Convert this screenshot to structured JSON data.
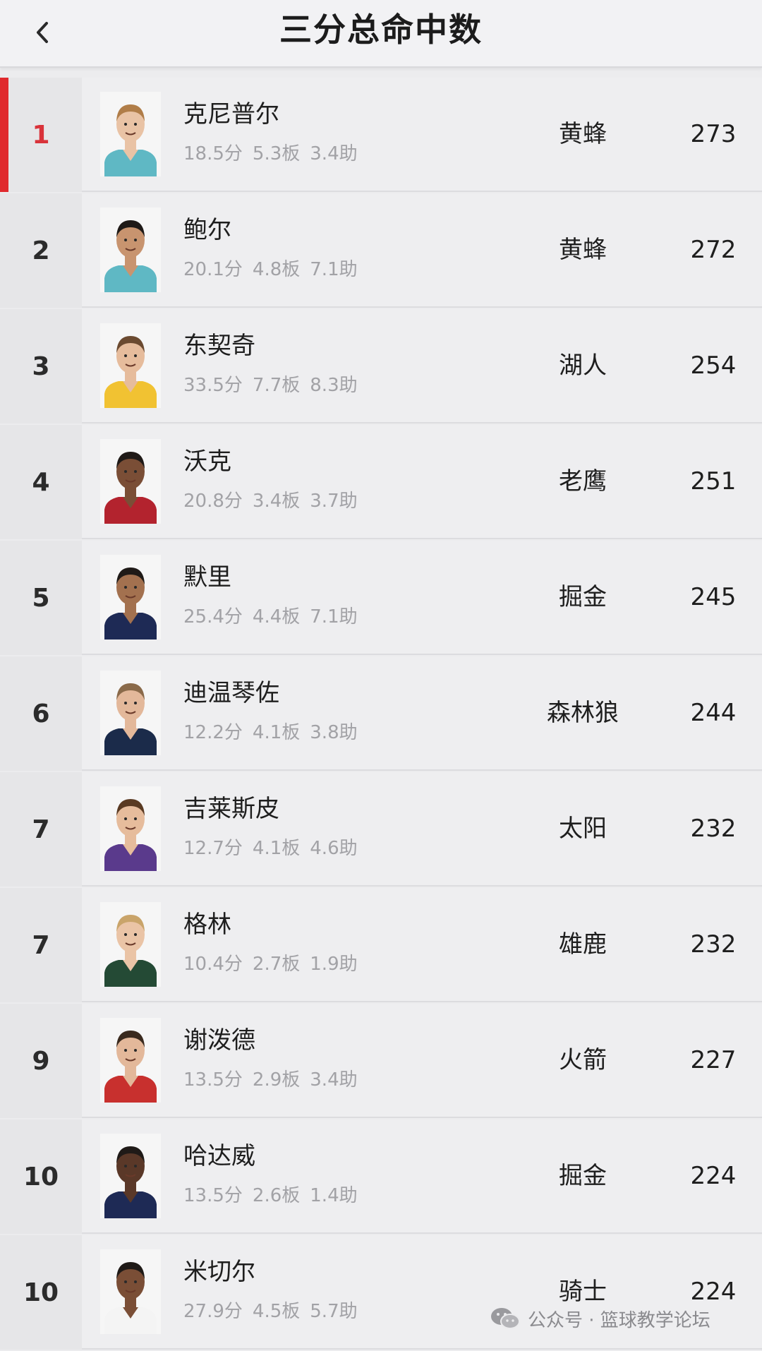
{
  "header": {
    "title": "三分总命中数"
  },
  "rows": [
    {
      "rank": "1",
      "name": "克尼普尔",
      "pts": "18.5分",
      "reb": "5.3板",
      "ast": "3.4助",
      "team": "黄蜂",
      "count": "273",
      "jersey": "#5fb8c4",
      "skin": "#e9c3a5",
      "hair": "#b07d48",
      "top": true
    },
    {
      "rank": "2",
      "name": "鲍尔",
      "pts": "20.1分",
      "reb": "4.8板",
      "ast": "7.1助",
      "team": "黄蜂",
      "count": "272",
      "jersey": "#5fb8c4",
      "skin": "#c8946f",
      "hair": "#1f1a17"
    },
    {
      "rank": "3",
      "name": "东契奇",
      "pts": "33.5分",
      "reb": "7.7板",
      "ast": "8.3助",
      "team": "湖人",
      "count": "254",
      "jersey": "#f1c232",
      "skin": "#e6bc9c",
      "hair": "#6b4a30"
    },
    {
      "rank": "4",
      "name": "沃克",
      "pts": "20.8分",
      "reb": "3.4板",
      "ast": "3.7助",
      "team": "老鹰",
      "count": "251",
      "jersey": "#b3232e",
      "skin": "#7a4e36",
      "hair": "#1f1a17"
    },
    {
      "rank": "5",
      "name": "默里",
      "pts": "25.4分",
      "reb": "4.4板",
      "ast": "7.1助",
      "team": "掘金",
      "count": "245",
      "jersey": "#1e2a55",
      "skin": "#a3714f",
      "hair": "#1f1a17"
    },
    {
      "rank": "6",
      "name": "迪温琴佐",
      "pts": "12.2分",
      "reb": "4.1板",
      "ast": "3.8助",
      "team": "森林狼",
      "count": "244",
      "jersey": "#1b2b4a",
      "skin": "#e3b89a",
      "hair": "#8a6a4a"
    },
    {
      "rank": "7",
      "name": "吉莱斯皮",
      "pts": "12.7分",
      "reb": "4.1板",
      "ast": "4.6助",
      "team": "太阳",
      "count": "232",
      "jersey": "#5a3a8c",
      "skin": "#e6bc9c",
      "hair": "#5a3a22"
    },
    {
      "rank": "7",
      "name": "格林",
      "pts": "10.4分",
      "reb": "2.7板",
      "ast": "1.9助",
      "team": "雄鹿",
      "count": "232",
      "jersey": "#244a35",
      "skin": "#eac4a6",
      "hair": "#c9a46a"
    },
    {
      "rank": "9",
      "name": "谢泼德",
      "pts": "13.5分",
      "reb": "2.9板",
      "ast": "3.4助",
      "team": "火箭",
      "count": "227",
      "jersey": "#c8302e",
      "skin": "#e3b89a",
      "hair": "#3a2a1e"
    },
    {
      "rank": "10",
      "name": "哈达威",
      "pts": "13.5分",
      "reb": "2.6板",
      "ast": "1.4助",
      "team": "掘金",
      "count": "224",
      "jersey": "#1e2a55",
      "skin": "#5a3828",
      "hair": "#1f1a17"
    },
    {
      "rank": "10",
      "name": "米切尔",
      "pts": "27.9分",
      "reb": "4.5板",
      "ast": "5.7助",
      "team": "骑士",
      "count": "224",
      "jersey": "#f4f4f4",
      "skin": "#7a4e36",
      "hair": "#1f1a17"
    }
  ],
  "watermark": {
    "text": "公众号 · 篮球教学论坛"
  },
  "colors": {
    "accent": "#e02a2e",
    "background": "#ececee"
  }
}
